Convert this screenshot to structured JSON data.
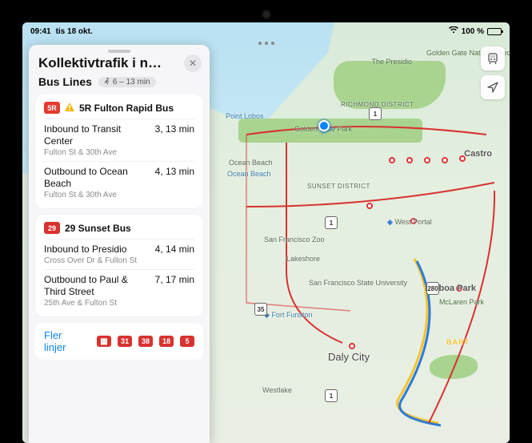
{
  "status": {
    "time": "09:41",
    "date": "tis 18 okt.",
    "battery_pct": "100 %",
    "wifi_glyph": "▲"
  },
  "panel": {
    "title": "Kollektivtrafik i n…",
    "section_title": "Bus Lines",
    "walk_range": "6 – 13 min",
    "walk_glyph": "Ὣ6",
    "close_glyph": "✕",
    "more_lines_label": "Fler linjer"
  },
  "lines": [
    {
      "badge": "5R",
      "badge_color": "#e33b2e",
      "has_alert": true,
      "name": "5R Fulton Rapid Bus",
      "dirs": [
        {
          "title": "Inbound to Transit Center",
          "stop": "Fulton St & 30th Ave",
          "eta": "3, 13 min"
        },
        {
          "title": "Outbound to Ocean Beach",
          "stop": "Fulton St & 30th Ave",
          "eta": "4, 13 min"
        }
      ]
    },
    {
      "badge": "29",
      "badge_color": "#d8322f",
      "has_alert": false,
      "name": "29 Sunset Bus",
      "dirs": [
        {
          "title": "Inbound to Presidio",
          "stop": "Cross Over Dr & Fulton St",
          "eta": "4, 14 min"
        },
        {
          "title": "Outbound to Paul & Third Street",
          "stop": "25th Ave & Fulton St",
          "eta": "7, 17 min"
        }
      ]
    }
  ],
  "more_badges": [
    {
      "label": "▦",
      "color": "#d8322f",
      "is_icon": true
    },
    {
      "label": "31",
      "color": "#d8322f"
    },
    {
      "label": "38",
      "color": "#d8322f"
    },
    {
      "label": "18",
      "color": "#d8322f"
    },
    {
      "label": "5",
      "color": "#d8322f"
    }
  ],
  "map": {
    "labels": {
      "presidio": "The Presidio",
      "ggnra": "Golden Gate National Recreation Area",
      "point_lobos": "Point Lobos",
      "richmond": "RICHMOND DISTRICT",
      "ggp": "Golden Gate Park",
      "ocean_beach": "Ocean Beach",
      "sunset": "SUNSET DISTRICT",
      "castro": "Castro",
      "west_portal": "West Portal",
      "sfzoo": "San Francisco Zoo",
      "lakeshore": "Lakeshore",
      "sfsu": "San Francisco State University",
      "fort_funston": "Fort Funston",
      "balboa": "Balboa Park",
      "mclaren": "McLaren Park",
      "daly_city": "Daly City",
      "westlake": "Westlake",
      "bart": "BART"
    },
    "shields": {
      "one": "1",
      "i280": "280",
      "thirtyfive": "35"
    }
  },
  "colors": {
    "system_blue": "#0a84ff"
  }
}
